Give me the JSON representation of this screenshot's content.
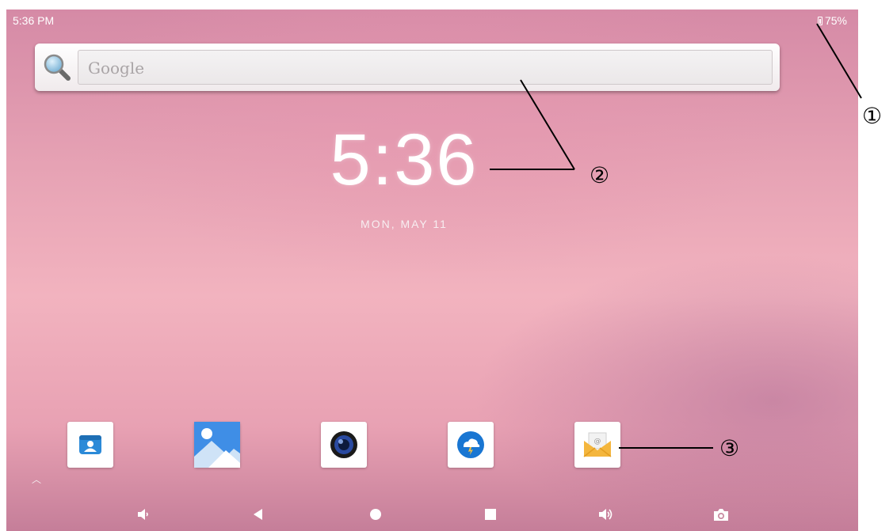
{
  "status_bar": {
    "time": "5:36 PM",
    "battery": "75%"
  },
  "search": {
    "placeholder": "Google",
    "icon": "search-icon"
  },
  "clock_widget": {
    "time": "5:36",
    "date": "MON, MAY 11"
  },
  "dock": {
    "apps": [
      {
        "icon": "contacts-icon",
        "color": "#2b8ad8"
      },
      {
        "icon": "gallery-icon",
        "color": "#3f8ee6"
      },
      {
        "icon": "camera-icon",
        "color": "#1d3f8c"
      },
      {
        "icon": "weather-icon",
        "color": "#1976d2"
      },
      {
        "icon": "email-icon",
        "color": "#f4b63d"
      }
    ]
  },
  "nav_bar": {
    "buttons": [
      "volume-down-icon",
      "back-icon",
      "home-icon",
      "recents-icon",
      "volume-up-icon",
      "screenshot-icon"
    ]
  },
  "annotations": {
    "one": "①",
    "two": "②",
    "three": "③"
  }
}
